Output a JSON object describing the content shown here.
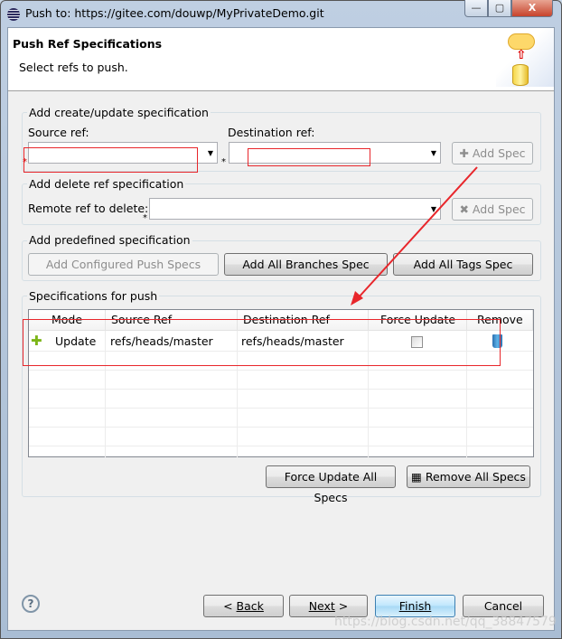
{
  "window": {
    "title": "Push to: https://gitee.com/douwp/MyPrivateDemo.git",
    "minimize": "—",
    "maximize": "▢",
    "close": "X"
  },
  "header": {
    "title": "Push Ref Specifications",
    "description": "Select refs to push."
  },
  "create_group": {
    "label": "Add create/update specification",
    "source_label": "Source ref:",
    "source_value": "",
    "destination_label": "Destination ref:",
    "destination_value": "",
    "add_spec": "Add Spec"
  },
  "delete_group": {
    "label": "Add delete ref specification",
    "remote_label": "Remote ref to delete:",
    "remote_value": "",
    "add_spec": "Add Spec"
  },
  "predefined_group": {
    "label": "Add predefined specification",
    "configured": "Add Configured Push Specs",
    "all_branches": "Add All Branches Spec",
    "all_tags": "Add All Tags Spec"
  },
  "specs_group": {
    "label": "Specifications for push",
    "columns": [
      "Mode",
      "Source Ref",
      "Destination Ref",
      "Force Update",
      "Remove"
    ],
    "rows": [
      {
        "mode": "Update",
        "source": "refs/heads/master",
        "destination": "refs/heads/master",
        "force_update": false
      }
    ],
    "force_all": "Force Update All Specs",
    "remove_all": "Remove All Specs"
  },
  "footer": {
    "back": "Back",
    "next": "Next",
    "finish": "Finish",
    "cancel": "Cancel"
  },
  "watermark": "https://blog.csdn.net/qq_38847579",
  "colors": {
    "annotation": "#e8262b",
    "default_button": "#3c7fb1"
  }
}
